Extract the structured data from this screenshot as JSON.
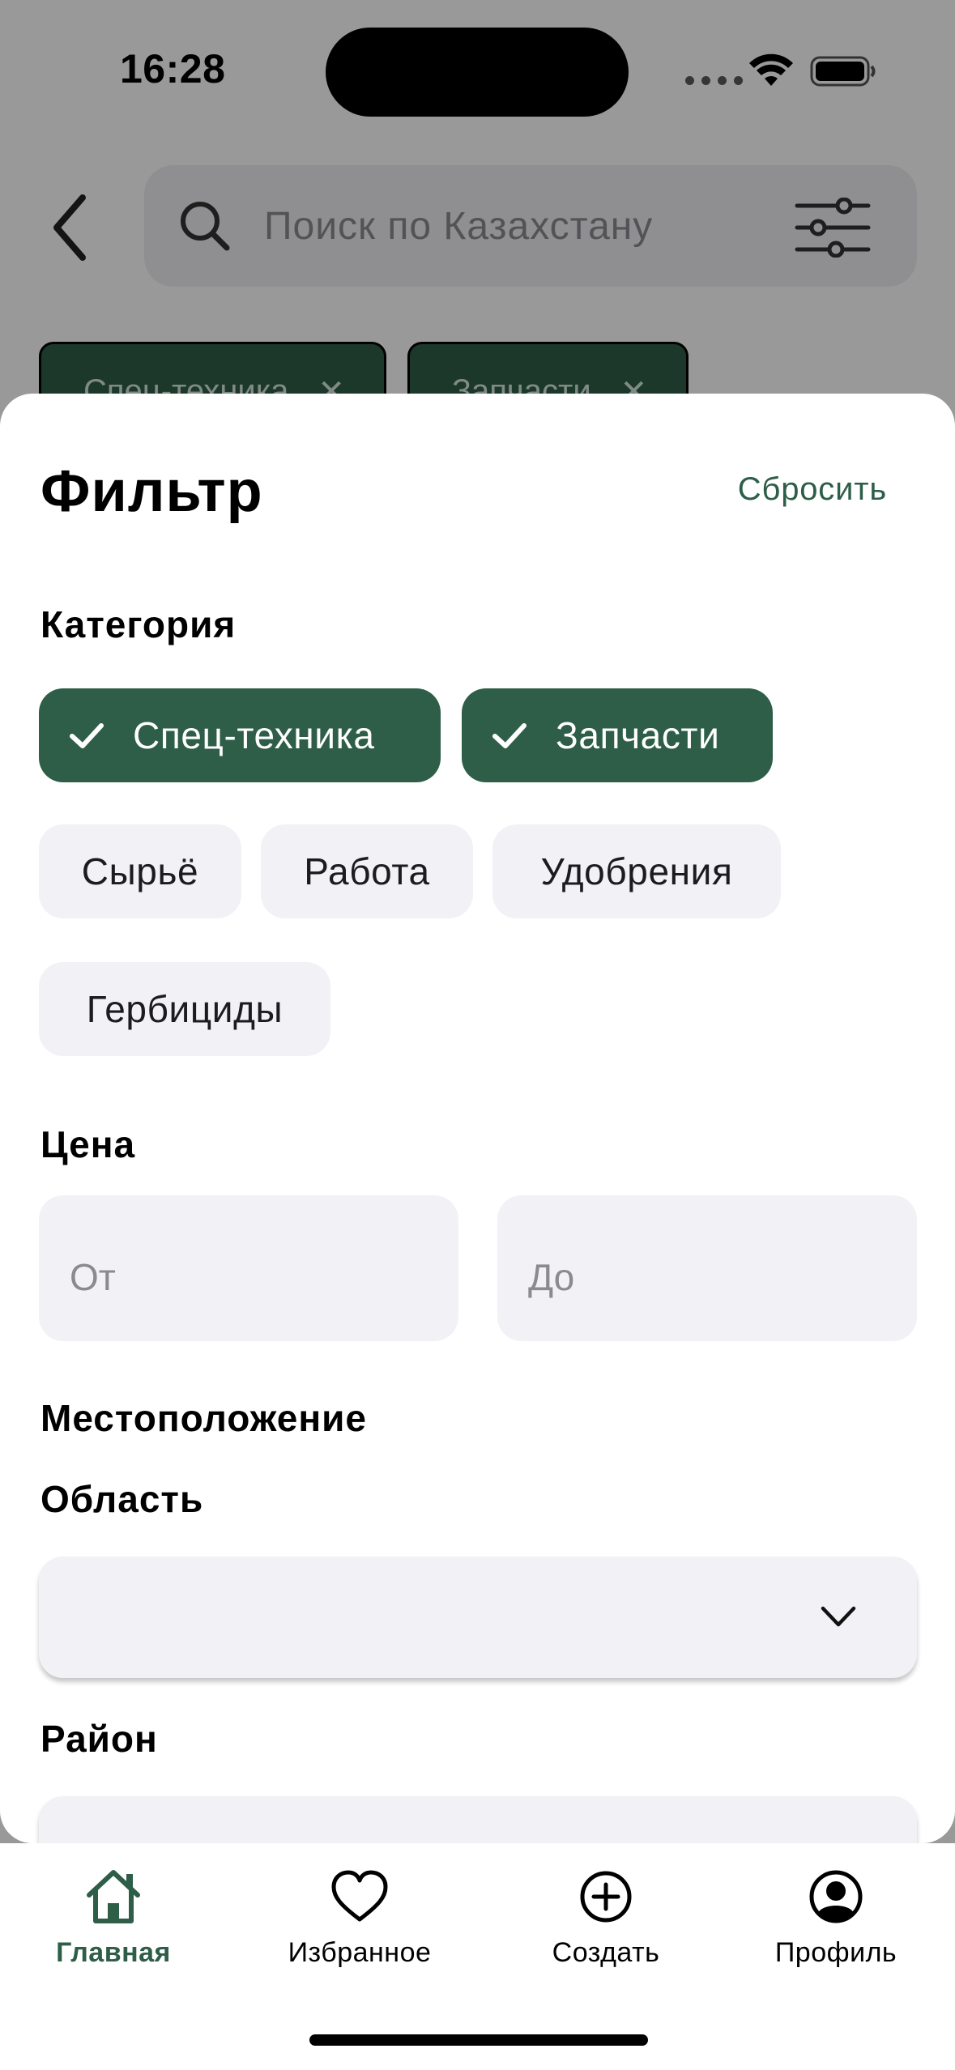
{
  "status": {
    "time": "16:28"
  },
  "search": {
    "placeholder": "Поиск по Казахстану"
  },
  "active_filters": [
    "Спец-техника",
    "Запчасти"
  ],
  "filter": {
    "title": "Фильтр",
    "reset_label": "Сбросить",
    "category": {
      "label": "Категория",
      "selected": [
        "Спец-техника",
        "Запчасти"
      ],
      "options": [
        "Сырьё",
        "Работа",
        "Удобрения",
        "Гербициды"
      ]
    },
    "price": {
      "label": "Цена",
      "from_placeholder": "От",
      "to_placeholder": "До"
    },
    "location": {
      "label": "Местоположение",
      "region_label": "Область",
      "region_value": "",
      "district_label": "Район"
    }
  },
  "tab_bar": {
    "items": [
      {
        "label": "Главная",
        "icon": "home-icon",
        "active": true
      },
      {
        "label": "Избранное",
        "icon": "heart-icon",
        "active": false
      },
      {
        "label": "Создать",
        "icon": "plus-circle-icon",
        "active": false
      },
      {
        "label": "Профиль",
        "icon": "profile-icon",
        "active": false
      }
    ]
  },
  "colors": {
    "accent": "#2e5e48",
    "chip_bg": "#f1f1f6"
  }
}
